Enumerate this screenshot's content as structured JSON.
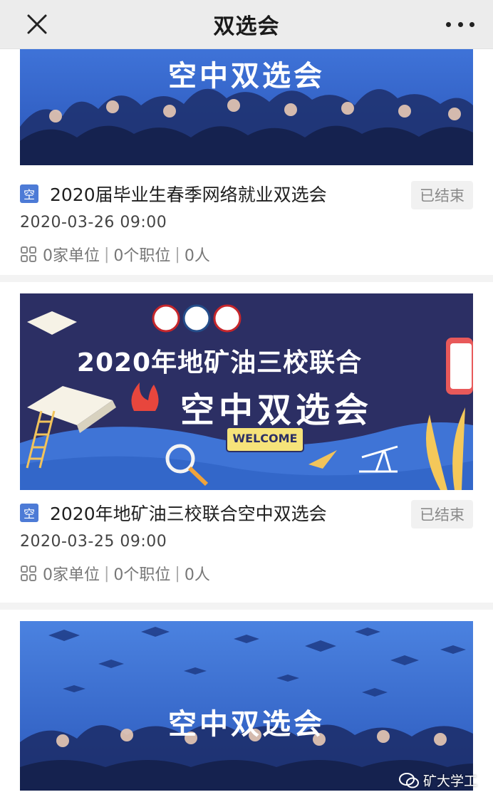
{
  "header": {
    "title": "双选会",
    "close_icon": "close-icon",
    "more_icon": "more-dots-icon"
  },
  "events": [
    {
      "banner_text": "空中双选会",
      "tag": "空",
      "title": "2020届毕业生春季网络就业双选会",
      "status": "已结束",
      "time": "2020-03-26 09:00",
      "companies": "0家单位",
      "positions": "0个职位",
      "people": "0人"
    },
    {
      "banner_title": "2020年地矿油三校联合",
      "banner_text": "空中双选会",
      "banner_welcome": "WELCOME",
      "tag": "空",
      "title": "2020年地矿油三校联合空中双选会",
      "status": "已结束",
      "time": "2020-03-25 09:00",
      "companies": "0家单位",
      "positions": "0个职位",
      "people": "0人"
    },
    {
      "banner_text": "空中双选会"
    }
  ],
  "watermark": {
    "text": "矿大学工",
    "icon": "wechat-icon"
  },
  "colors": {
    "banner_blue": "#3f73d8",
    "banner_navy": "#2c2f64",
    "tag_blue": "#4d7bd6",
    "status_gray": "#8a8a8a"
  }
}
